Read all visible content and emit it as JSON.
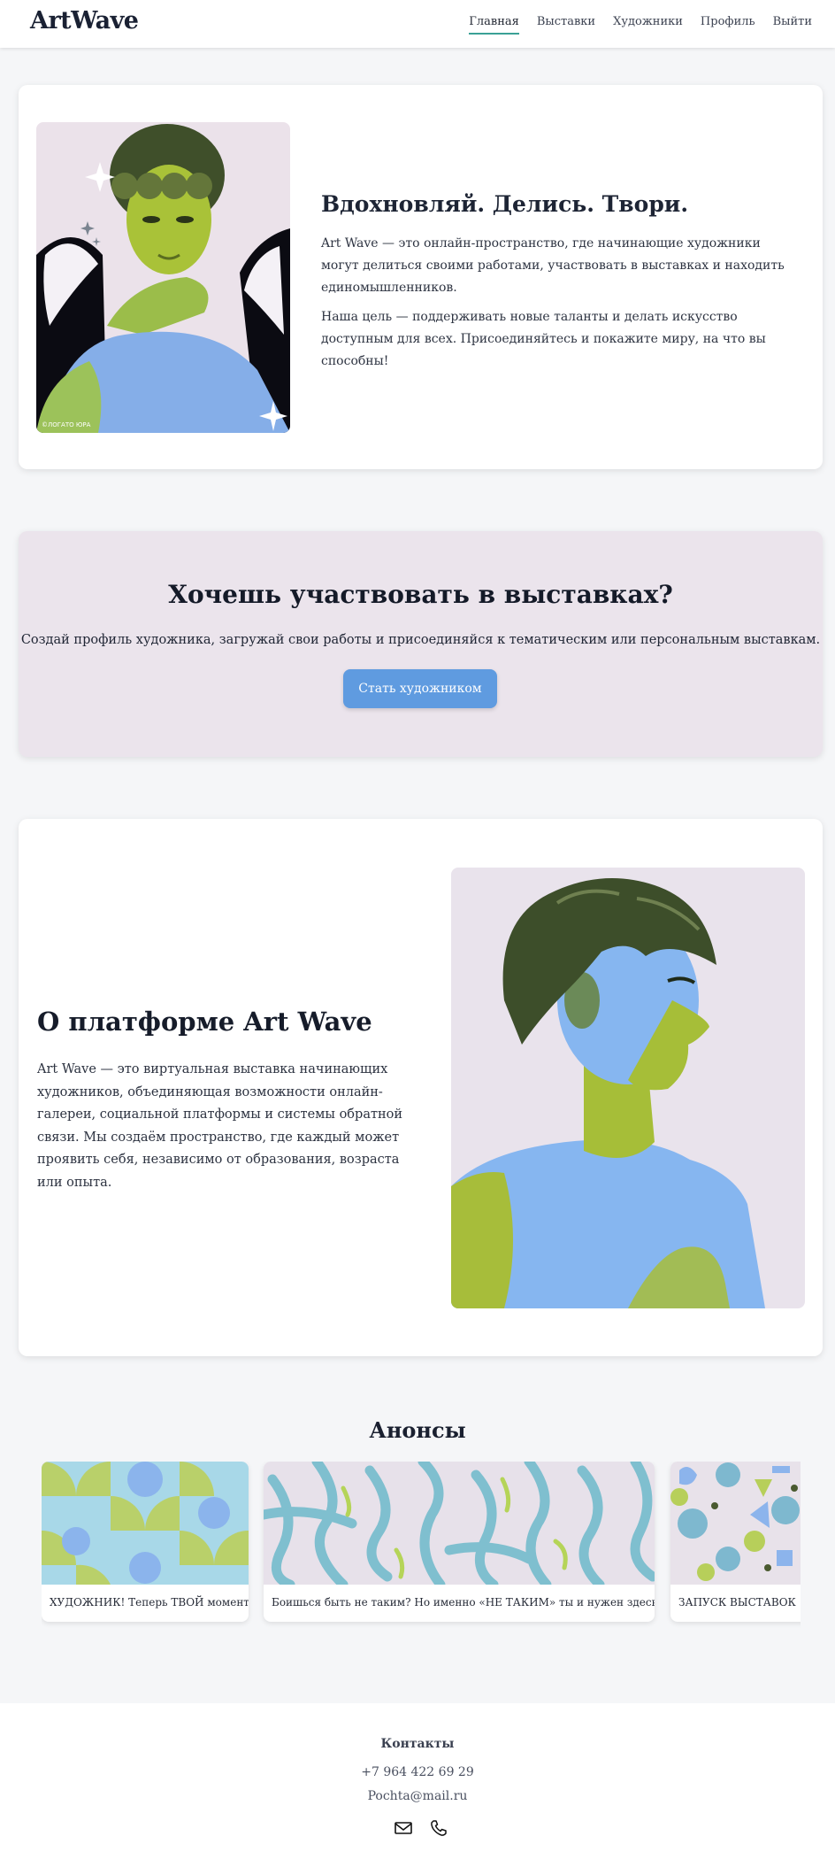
{
  "header": {
    "logo": "ArtWave",
    "nav": [
      "Главная",
      "Выставки",
      "Художники",
      "Профиль",
      "Выйти"
    ]
  },
  "hero": {
    "title": "Вдохновляй. Делись. Твори.",
    "p1": "Art Wave — это онлайн-пространство, где начинающие художники могут делиться своими работами, участвовать в выставках и находить единомышленников.",
    "p2": "Наша цель — поддерживать новые таланты и делать искусство доступным для всех. Присоединяйтесь и покажите миру, на что вы способны!",
    "image_signature": "©ЛОГАТО ЮРА"
  },
  "cta": {
    "title": "Хочешь участвовать в выставках?",
    "subtitle": "Создай профиль художника, загружай свои работы и присоединяйся к тематическим или персональным выставкам.",
    "button": "Стать художником"
  },
  "about": {
    "title": "О платформе Art Wave",
    "text": "Art Wave — это виртуальная выставка начинающих художников, объединяющая возможности онлайн-галереи, социальной платформы и системы обратной связи. Мы создаём пространство, где каждый может проявить себя, независимо от образования, возраста или опыта."
  },
  "announcements": {
    "title": "Анонсы",
    "items": [
      "ХУДОЖНИК! Теперь ТВОЙ момент!",
      "Боишься быть не таким? Но именно «НЕ ТАКИМ» ты и нужен здесь.",
      "ЗАПУСК ВЫСТАВОК"
    ]
  },
  "footer": {
    "title": "Контакты",
    "phone": "+7 964 422 69 29",
    "email": "Pochta@mail.ru",
    "icons": [
      "mail-icon",
      "phone-icon"
    ]
  },
  "colors": {
    "accent": "#3aa196",
    "button": "#5f9be0",
    "cta_bg": "#ebe4ec",
    "art_green": "#a8bd3a",
    "art_blue": "#86b6f0",
    "art_lilac": "#e9e3ec"
  }
}
